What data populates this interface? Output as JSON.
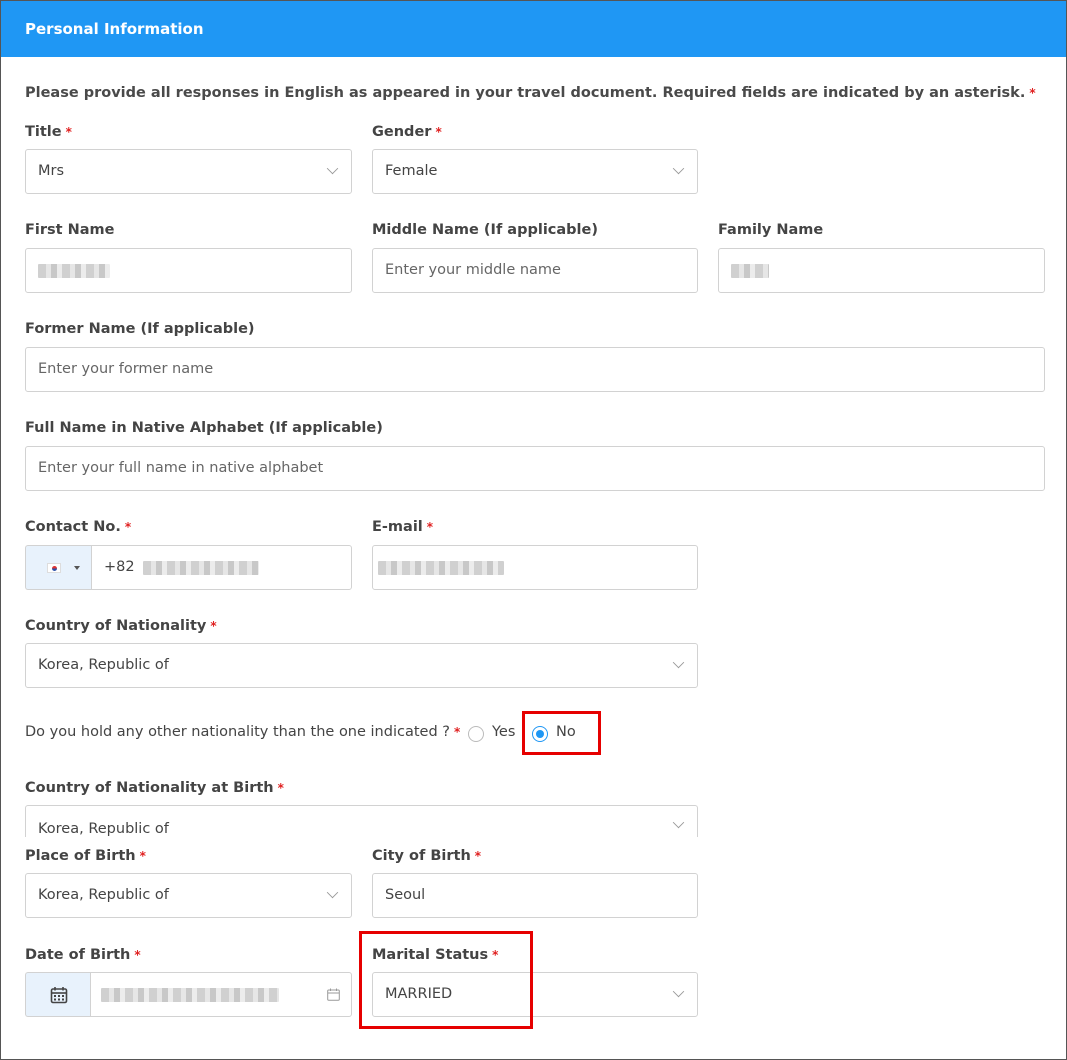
{
  "section_title": "Personal Information",
  "instructions": "Please provide all responses in English as appeared in your travel document. Required fields are indicated by an asterisk.",
  "required_mark": "*",
  "title": {
    "label": "Title",
    "value": "Mrs"
  },
  "gender": {
    "label": "Gender",
    "value": "Female"
  },
  "first_name": {
    "label": "First Name"
  },
  "middle_name": {
    "label": "Middle Name (If applicable)",
    "placeholder": "Enter your middle name"
  },
  "family_name": {
    "label": "Family Name"
  },
  "former_name": {
    "label": "Former Name (If applicable)",
    "placeholder": "Enter your former name"
  },
  "native_name": {
    "label": "Full Name in Native Alphabet (If applicable)",
    "placeholder": "Enter your full name in native alphabet"
  },
  "contact": {
    "label": "Contact No.",
    "dial_code": "+82"
  },
  "email": {
    "label": "E-mail"
  },
  "nationality": {
    "label": "Country of Nationality",
    "value": "Korea, Republic of"
  },
  "other_nationality": {
    "question": "Do you hold any other nationality than the one indicated ?",
    "options": [
      "Yes",
      "No"
    ],
    "selected": "No"
  },
  "nationality_birth": {
    "label": "Country of Nationality at Birth",
    "value": "Korea, Republic of"
  },
  "place_of_birth": {
    "label": "Place of Birth",
    "value": "Korea, Republic of"
  },
  "city_of_birth": {
    "label": "City of Birth",
    "value": "Seoul"
  },
  "date_of_birth": {
    "label": "Date of Birth"
  },
  "marital_status": {
    "label": "Marital Status",
    "value": "MARRIED"
  },
  "colors": {
    "header": "#1f97f4",
    "required": "#e02020",
    "highlight": "#e60000"
  },
  "icons": [
    "chevron-down-icon",
    "korea-flag-icon",
    "calendar-icon"
  ]
}
